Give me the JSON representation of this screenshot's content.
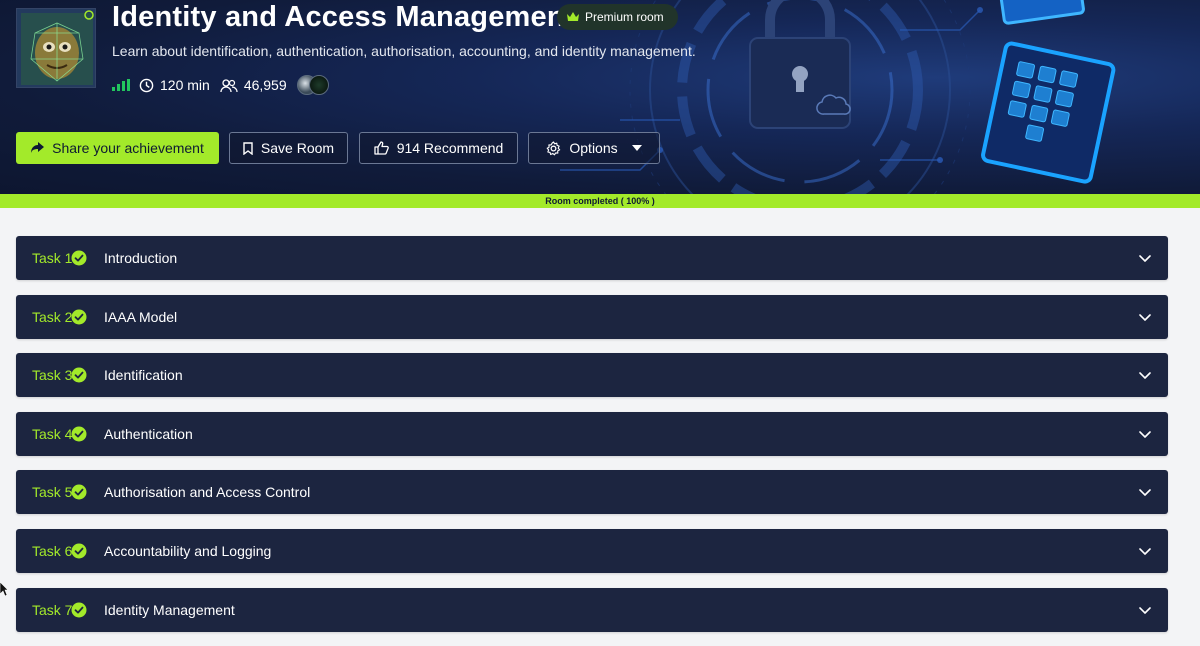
{
  "room": {
    "title": "Identity and Access Management",
    "badge": "Premium room",
    "description": "Learn about identification, authentication, authorisation, accounting, and identity management.",
    "duration": "120 min",
    "users": "46,959"
  },
  "actions": {
    "share": "Share your achievement",
    "save": "Save Room",
    "recommend": "914 Recommend",
    "options": "Options"
  },
  "progress": {
    "label": "Room completed ( 100% )",
    "fraction": 1.0
  },
  "tasks": [
    {
      "number": "Task 1",
      "title": "Introduction"
    },
    {
      "number": "Task 2",
      "title": "IAAA Model"
    },
    {
      "number": "Task 3",
      "title": "Identification"
    },
    {
      "number": "Task 4",
      "title": "Authentication"
    },
    {
      "number": "Task 5",
      "title": "Authorisation and Access Control"
    },
    {
      "number": "Task 6",
      "title": "Accountability and Logging"
    },
    {
      "number": "Task 7",
      "title": "Identity Management"
    }
  ],
  "colors": {
    "accent": "#a3ea2a",
    "header_bg": "#101b3a",
    "task_bg": "#1c2540",
    "page_bg": "#f3f4f6"
  },
  "icons": [
    "room-avatar-icon",
    "crown-icon",
    "difficulty-signal-icon",
    "clock-icon",
    "users-icon",
    "share-icon",
    "bookmark-icon",
    "thumbs-up-icon",
    "gear-icon",
    "caret-down-icon",
    "check-circle-icon",
    "chevron-down-icon"
  ]
}
